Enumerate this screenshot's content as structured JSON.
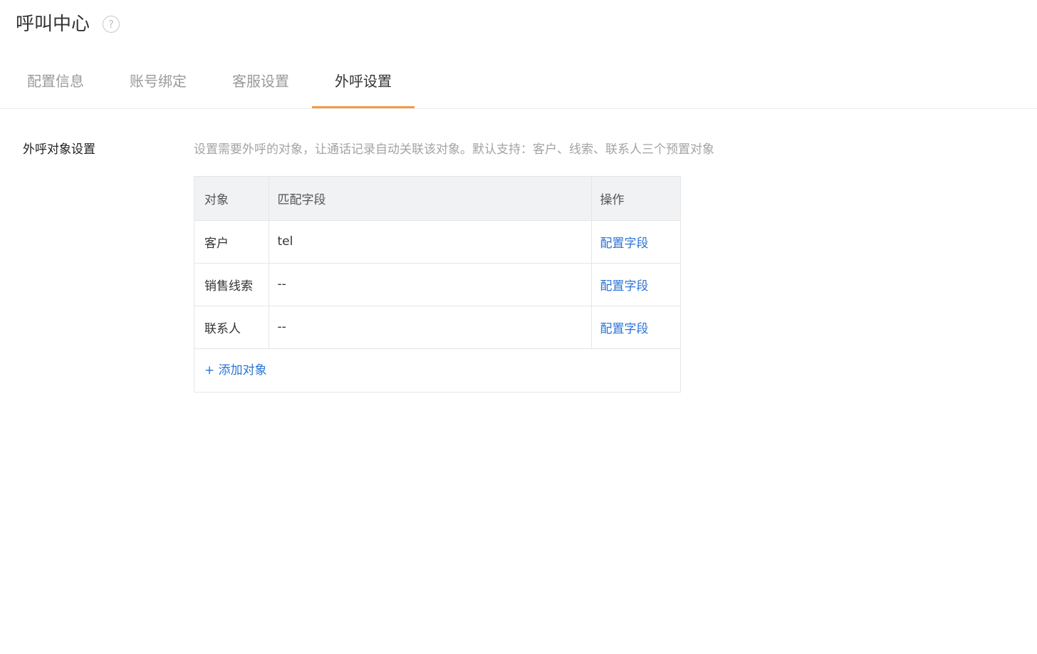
{
  "header": {
    "title": "呼叫中心",
    "help_glyph": "?"
  },
  "tabs": [
    {
      "label": "配置信息",
      "active": false
    },
    {
      "label": "账号绑定",
      "active": false
    },
    {
      "label": "客服设置",
      "active": false
    },
    {
      "label": "外呼设置",
      "active": true
    }
  ],
  "accent_color": "#f59a46",
  "link_color": "#2a74d4",
  "section": {
    "label": "外呼对象设置",
    "description": "设置需要外呼的对象，让通话记录自动关联该对象。默认支持：客户、线索、联系人三个预置对象"
  },
  "table": {
    "columns": [
      "对象",
      "匹配字段",
      "操作"
    ],
    "rows": [
      {
        "object": "客户",
        "field": "tel",
        "action": "配置字段"
      },
      {
        "object": "销售线索",
        "field": "--",
        "action": "配置字段"
      },
      {
        "object": "联系人",
        "field": "--",
        "action": "配置字段"
      }
    ],
    "add_label": "+ 添加对象"
  }
}
